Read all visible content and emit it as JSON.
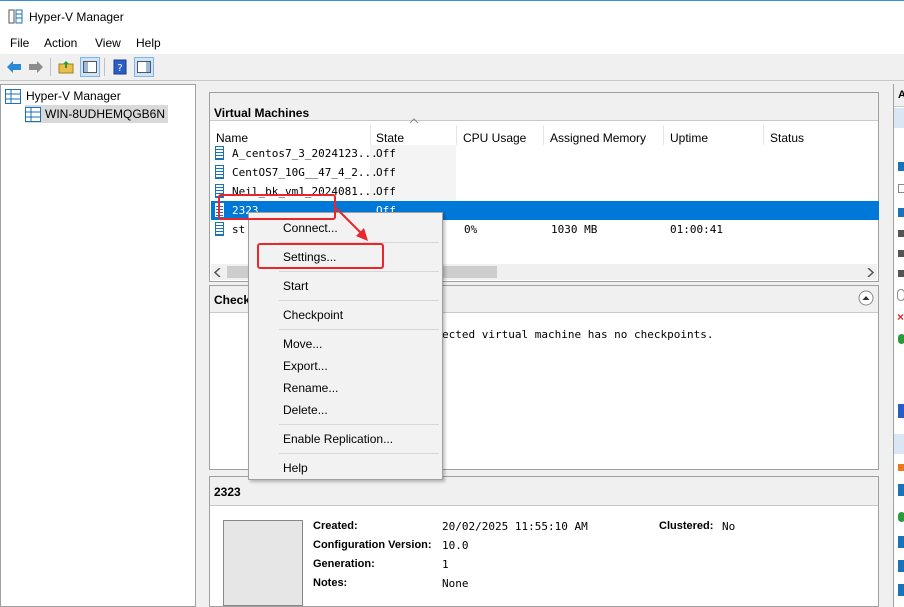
{
  "window": {
    "title": "Hyper-V Manager"
  },
  "menu": [
    "File",
    "Action",
    "View",
    "Help"
  ],
  "tree": {
    "root": "Hyper-V Manager",
    "server": "WIN-8UDHEMQGB6N"
  },
  "vm_panel": {
    "title": "Virtual Machines",
    "columns": [
      "Name",
      "State",
      "CPU Usage",
      "Assigned Memory",
      "Uptime",
      "Status"
    ],
    "rows": [
      {
        "name": "A_centos7_3_2024123...",
        "state": "Off",
        "cpu": "",
        "memory": "",
        "uptime": "",
        "status": ""
      },
      {
        "name": "CentOS7_10G__47_4_2...",
        "state": "Off",
        "cpu": "",
        "memory": "",
        "uptime": "",
        "status": ""
      },
      {
        "name": "Neil_bk_vm1_2024081...",
        "state": "Off",
        "cpu": "",
        "memory": "",
        "uptime": "",
        "status": ""
      },
      {
        "name": "2323",
        "state": "Off",
        "cpu": "",
        "memory": "",
        "uptime": "",
        "status": ""
      },
      {
        "name": "st",
        "state": "",
        "cpu": "0%",
        "memory": "1030 MB",
        "uptime": "01:00:41",
        "status": ""
      }
    ]
  },
  "checkpoints_panel": {
    "title": "Check",
    "message": "ected virtual machine has no checkpoints."
  },
  "details_panel": {
    "title": "2323",
    "created_label": "Created:",
    "created_value": "20/02/2025 11:55:10 AM",
    "config_label": "Configuration Version:",
    "config_value": "10.0",
    "generation_label": "Generation:",
    "generation_value": "1",
    "notes_label": "Notes:",
    "notes_value": "None",
    "clustered_label": "Clustered:",
    "clustered_value": "No"
  },
  "context_menu": {
    "connect": "Connect...",
    "settings": "Settings...",
    "start": "Start",
    "checkpoint": "Checkpoint",
    "move": "Move...",
    "export": "Export...",
    "rename": "Rename...",
    "delete": "Delete...",
    "enable_replication": "Enable Replication...",
    "help": "Help"
  },
  "actions_pane": {
    "header_letter": "A"
  },
  "colors": {
    "selection": "#0078d7",
    "annotation": "#e8262b",
    "accent": "#1a72b8"
  }
}
